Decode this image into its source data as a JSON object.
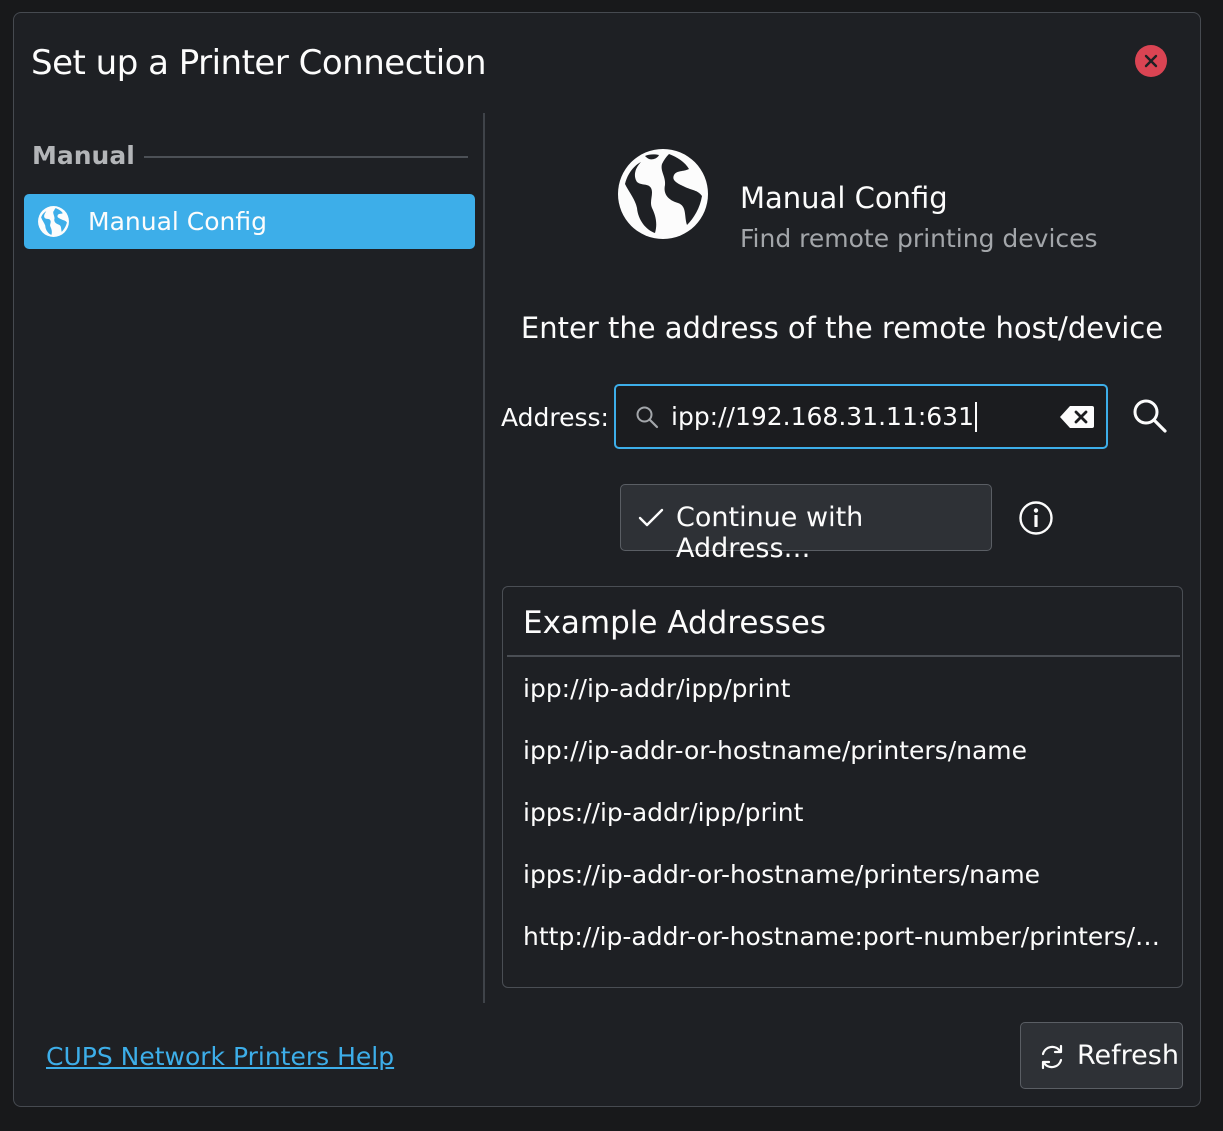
{
  "window": {
    "title": "Set up a Printer Connection",
    "close_icon": "close-icon"
  },
  "sidebar": {
    "group_header": "Manual",
    "items": [
      {
        "label": "Manual Config",
        "icon": "globe-icon",
        "selected": true
      }
    ]
  },
  "main": {
    "hero_title": "Manual Config",
    "hero_subtitle": "Find remote printing devices",
    "prompt": "Enter the address of the remote host/device",
    "address_label": "Address:",
    "address_value": "ipp://192.168.31.11:631",
    "continue_label": "Continue with Address…",
    "examples_header": "Example Addresses",
    "examples": [
      "ipp://ip-addr/ipp/print",
      "ipp://ip-addr-or-hostname/printers/name",
      "ipps://ip-addr/ipp/print",
      "ipps://ip-addr-or-hostname/printers/name",
      "http://ip-addr-or-hostname:port-number/printers/…"
    ]
  },
  "footer": {
    "help_link": "CUPS Network Printers Help",
    "refresh_label": "Refresh"
  },
  "colors": {
    "accent": "#3daee9",
    "close": "#da4453",
    "background": "#1e2024"
  }
}
